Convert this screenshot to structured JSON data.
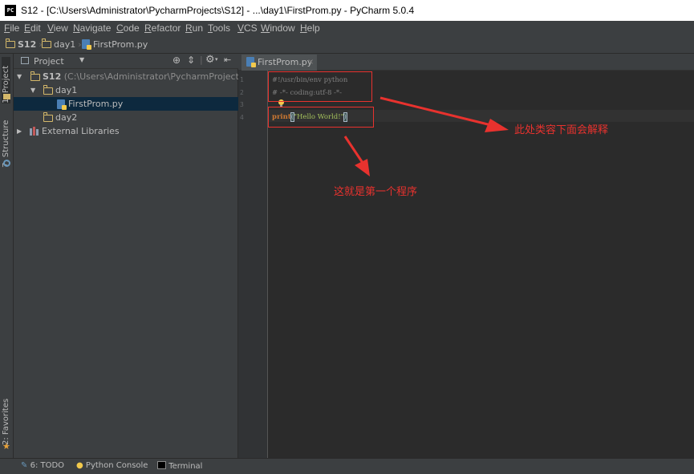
{
  "window": {
    "title": "S12 - [C:\\Users\\Administrator\\PycharmProjects\\S12] - ...\\day1\\FirstProm.py - PyCharm 5.0.4",
    "logo": "PC"
  },
  "menu": [
    "File",
    "Edit",
    "View",
    "Navigate",
    "Code",
    "Refactor",
    "Run",
    "Tools",
    "VCS",
    "Window",
    "Help"
  ],
  "breadcrumb": [
    "S12",
    "day1",
    "FirstProm.py"
  ],
  "left_stripe": {
    "project_tab": "1: Project",
    "structure_tab": "7: Structure",
    "favorites_tab": "2: Favorites"
  },
  "project_panel": {
    "header": "Project",
    "tree": {
      "root_name": "S12",
      "root_path": "(C:\\Users\\Administrator\\PycharmProjects\\S12)",
      "day1": "day1",
      "file": "FirstProm.py",
      "day2": "day2",
      "libs": "External Libraries"
    }
  },
  "editor": {
    "tab_label": "FirstProm.py",
    "line_numbers": [
      "1",
      "2",
      "3",
      "4"
    ],
    "line1": "#!/usr/bin/env python",
    "line2": "# -*- coding:utf-8 -*-",
    "line4_kw": "print",
    "line4_open": "(",
    "line4_str": "\"Hello World!\"",
    "line4_close": ")"
  },
  "annotations": {
    "header_note": "此处类容下面会解释",
    "program_note": "这就是第一个程序"
  },
  "status_bar": {
    "todo": "6: TODO",
    "console": "Python Console",
    "terminal": "Terminal"
  },
  "colors": {
    "annotation": "#e8322e",
    "selection": "#0d293e",
    "keyword": "#cc7832",
    "string": "#a5c25c"
  },
  "icons": [
    "pycharm-logo-icon",
    "folder-icon",
    "python-file-icon",
    "library-icon",
    "lightbulb-icon",
    "gear-icon",
    "target-icon",
    "close-icon",
    "terminal-icon"
  ]
}
